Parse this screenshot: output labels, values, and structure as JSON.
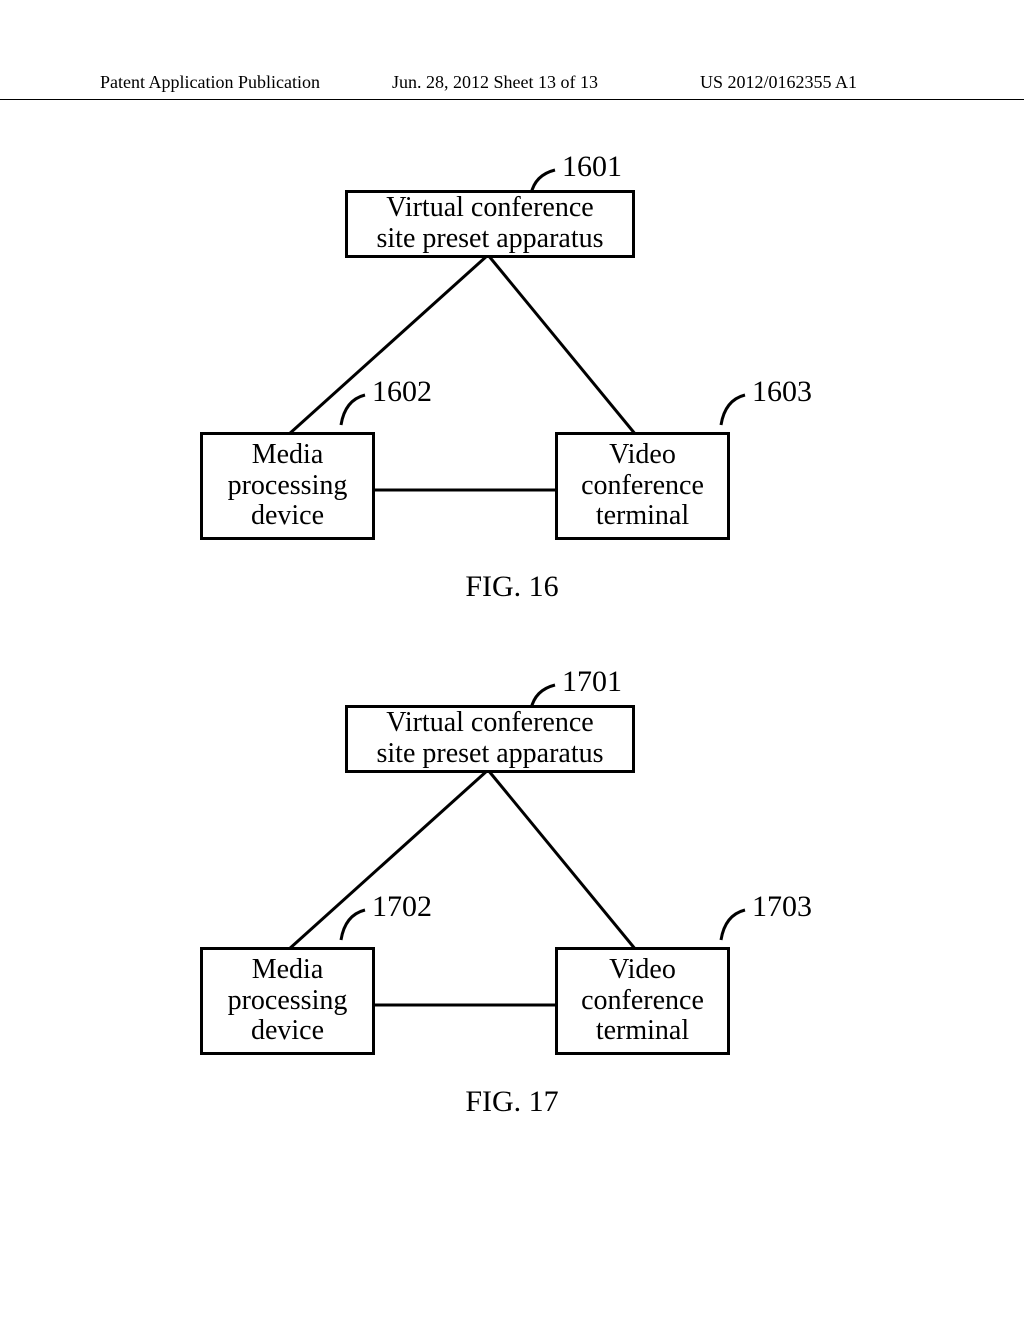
{
  "header": {
    "left": "Patent Application Publication",
    "center": "Jun. 28, 2012  Sheet 13 of 13",
    "right": "US 2012/0162355 A1"
  },
  "fig16": {
    "caption": "FIG. 16",
    "box1601": {
      "ref": "1601",
      "label": "Virtual conference\nsite preset apparatus"
    },
    "box1602": {
      "ref": "1602",
      "label": "Media\nprocessing\ndevice"
    },
    "box1603": {
      "ref": "1603",
      "label": "Video\nconference\nterminal"
    }
  },
  "fig17": {
    "caption": "FIG. 17",
    "box1701": {
      "ref": "1701",
      "label": "Virtual conference\nsite preset apparatus"
    },
    "box1702": {
      "ref": "1702",
      "label": "Media\nprocessing\ndevice"
    },
    "box1703": {
      "ref": "1703",
      "label": "Video\nconference\nterminal"
    }
  }
}
